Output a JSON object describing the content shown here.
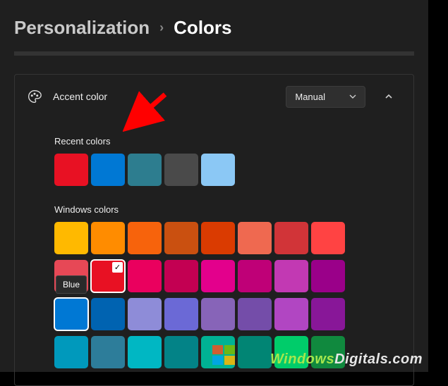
{
  "breadcrumb": {
    "parent": "Personalization",
    "current": "Colors"
  },
  "accent": {
    "label": "Accent color",
    "mode": "Manual"
  },
  "recent": {
    "heading": "Recent colors",
    "colors": [
      "#e81123",
      "#0078d4",
      "#2d7d8f",
      "#4a4a4a",
      "#8bc8f5"
    ]
  },
  "windows": {
    "heading": "Windows colors",
    "rows": [
      [
        "#ffb900",
        "#ff8c00",
        "#f7630c",
        "#ca5010",
        "#da3b01",
        "#ef6950",
        "#d13438",
        "#ff4343"
      ],
      [
        "#e74856",
        "#e81123",
        "#ea005e",
        "#c30052",
        "#e3008c",
        "#bf0077",
        "#c239b3",
        "#9a0089"
      ],
      [
        "#0078d4",
        "#0063b1",
        "#8e8cd8",
        "#6b69d6",
        "#8764b8",
        "#744da9",
        "#b146c2",
        "#881798"
      ],
      [
        "#0099bc",
        "#2d7d9a",
        "#00b7c3",
        "#038387",
        "#00b294",
        "#018574",
        "#00cc6a",
        "#10893e"
      ]
    ],
    "selected": {
      "row": 1,
      "col": 1
    },
    "hovered": {
      "row": 2,
      "col": 0,
      "tooltip": "Blue"
    }
  },
  "watermark": {
    "part1": "Windows",
    "part2": "Digitals.com"
  }
}
